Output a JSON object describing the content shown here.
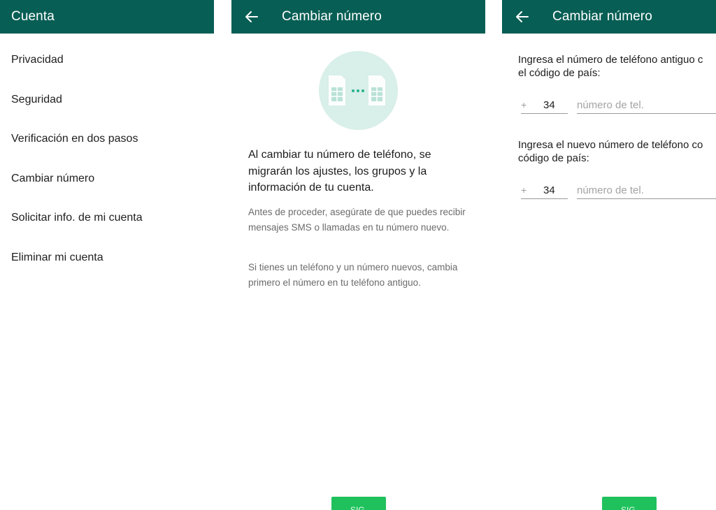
{
  "screen1": {
    "title": "Cuenta",
    "items": [
      {
        "label": "Privacidad"
      },
      {
        "label": "Seguridad"
      },
      {
        "label": "Verificación en dos pasos"
      },
      {
        "label": "Cambiar número"
      },
      {
        "label": "Solicitar info. de mi cuenta"
      },
      {
        "label": "Eliminar mi cuenta"
      }
    ]
  },
  "screen2": {
    "title": "Cambiar número",
    "lead": "Al cambiar tu número de teléfono, se migrarán los ajustes, los grupos y la información de tu cuenta.",
    "note1": "Antes de proceder, asegúrate de que puedes recibir mensajes SMS o llamadas en tu número nuevo.",
    "note2": "Si tienes un teléfono y un número nuevos, cambia primero el número en tu teléfono antiguo.",
    "button": "SIG."
  },
  "screen3": {
    "title": "Cambiar número",
    "old_prompt_line1": "Ingresa el número de teléfono antiguo c",
    "old_prompt_line2": "el código de país:",
    "new_prompt_line1": "Ingresa el nuevo número de teléfono co",
    "new_prompt_line2": "código de país:",
    "plus": "+",
    "old_country_code": "34",
    "new_country_code": "34",
    "phone_placeholder": "número de tel.",
    "button": "SIG."
  },
  "colors": {
    "appbar": "#075e54",
    "accent": "#1fc15c",
    "illustration_bg": "#d9efe9"
  },
  "icons": {
    "back": "arrow-left-icon",
    "illustration": "sim-cards-icon"
  }
}
